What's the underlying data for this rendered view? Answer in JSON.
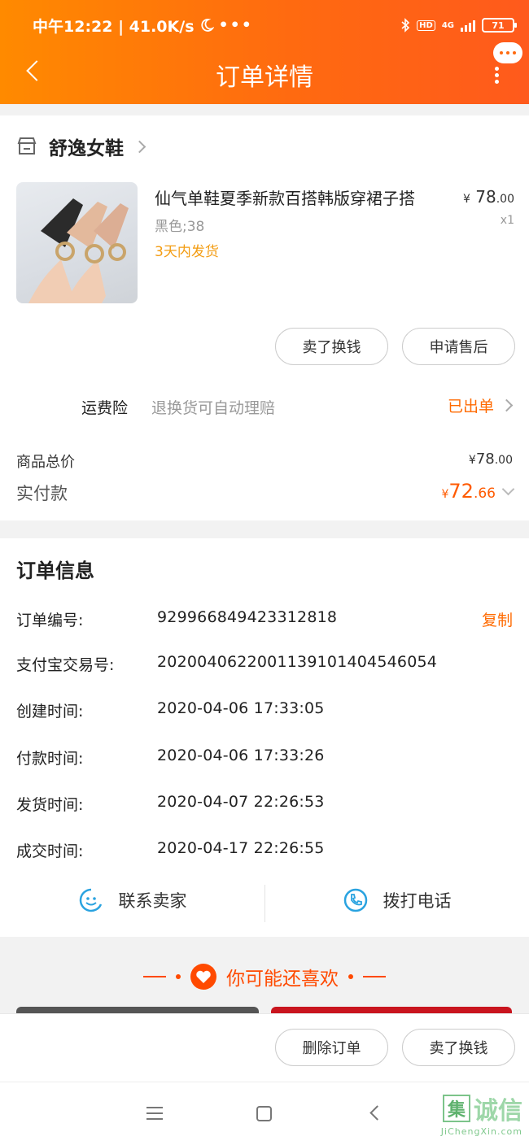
{
  "status_bar": {
    "time_speed": "中午12:22 | 41.0K/s",
    "network": "4G",
    "hd": "HD",
    "battery": "71"
  },
  "header": {
    "title": "订单详情"
  },
  "shop": {
    "name": "舒逸女鞋"
  },
  "product": {
    "title": "仙气单鞋夏季新款百搭韩版穿裙子搭",
    "price_currency": "¥",
    "price_int": "78",
    "price_dec": ".00",
    "spec": "黑色;38",
    "qty": "x1",
    "shipping_note": "3天内发货",
    "btn_sell": "卖了换钱",
    "btn_aftersale": "申请售后"
  },
  "insurance": {
    "label": "运费险",
    "desc": "退换货可自动理赔",
    "status": "已出单"
  },
  "totals": {
    "goods_label": "商品总价",
    "goods_currency": "¥",
    "goods_int": "78",
    "goods_dec": ".00",
    "paid_label": "实付款",
    "paid_currency": "¥",
    "paid_int": "72",
    "paid_dec": ".66"
  },
  "order_info": {
    "title": "订单信息",
    "copy_label": "复制",
    "rows": [
      {
        "label": "订单编号:",
        "value": "929966849423312818"
      },
      {
        "label": "支付宝交易号:",
        "value": "2020040622001139101404546054"
      },
      {
        "label": "创建时间:",
        "value": "2020-04-06 17:33:05"
      },
      {
        "label": "付款时间:",
        "value": "2020-04-06 17:33:26"
      },
      {
        "label": "发货时间:",
        "value": "2020-04-07 22:26:53"
      },
      {
        "label": "成交时间:",
        "value": "2020-04-17 22:26:55"
      }
    ],
    "contact_seller": "联系卖家",
    "call_phone": "拨打电话"
  },
  "recommend": {
    "title": "你可能还喜欢"
  },
  "action_bar": {
    "delete_order": "删除订单",
    "sell": "卖了换钱"
  },
  "watermark": {
    "main": "诚信",
    "box_char": "集",
    "sub": "JiChengXin.com"
  },
  "colors": {
    "brand_orange": "#ff6a10",
    "accent": "#ff5a00",
    "ship_note": "#f39c12"
  }
}
